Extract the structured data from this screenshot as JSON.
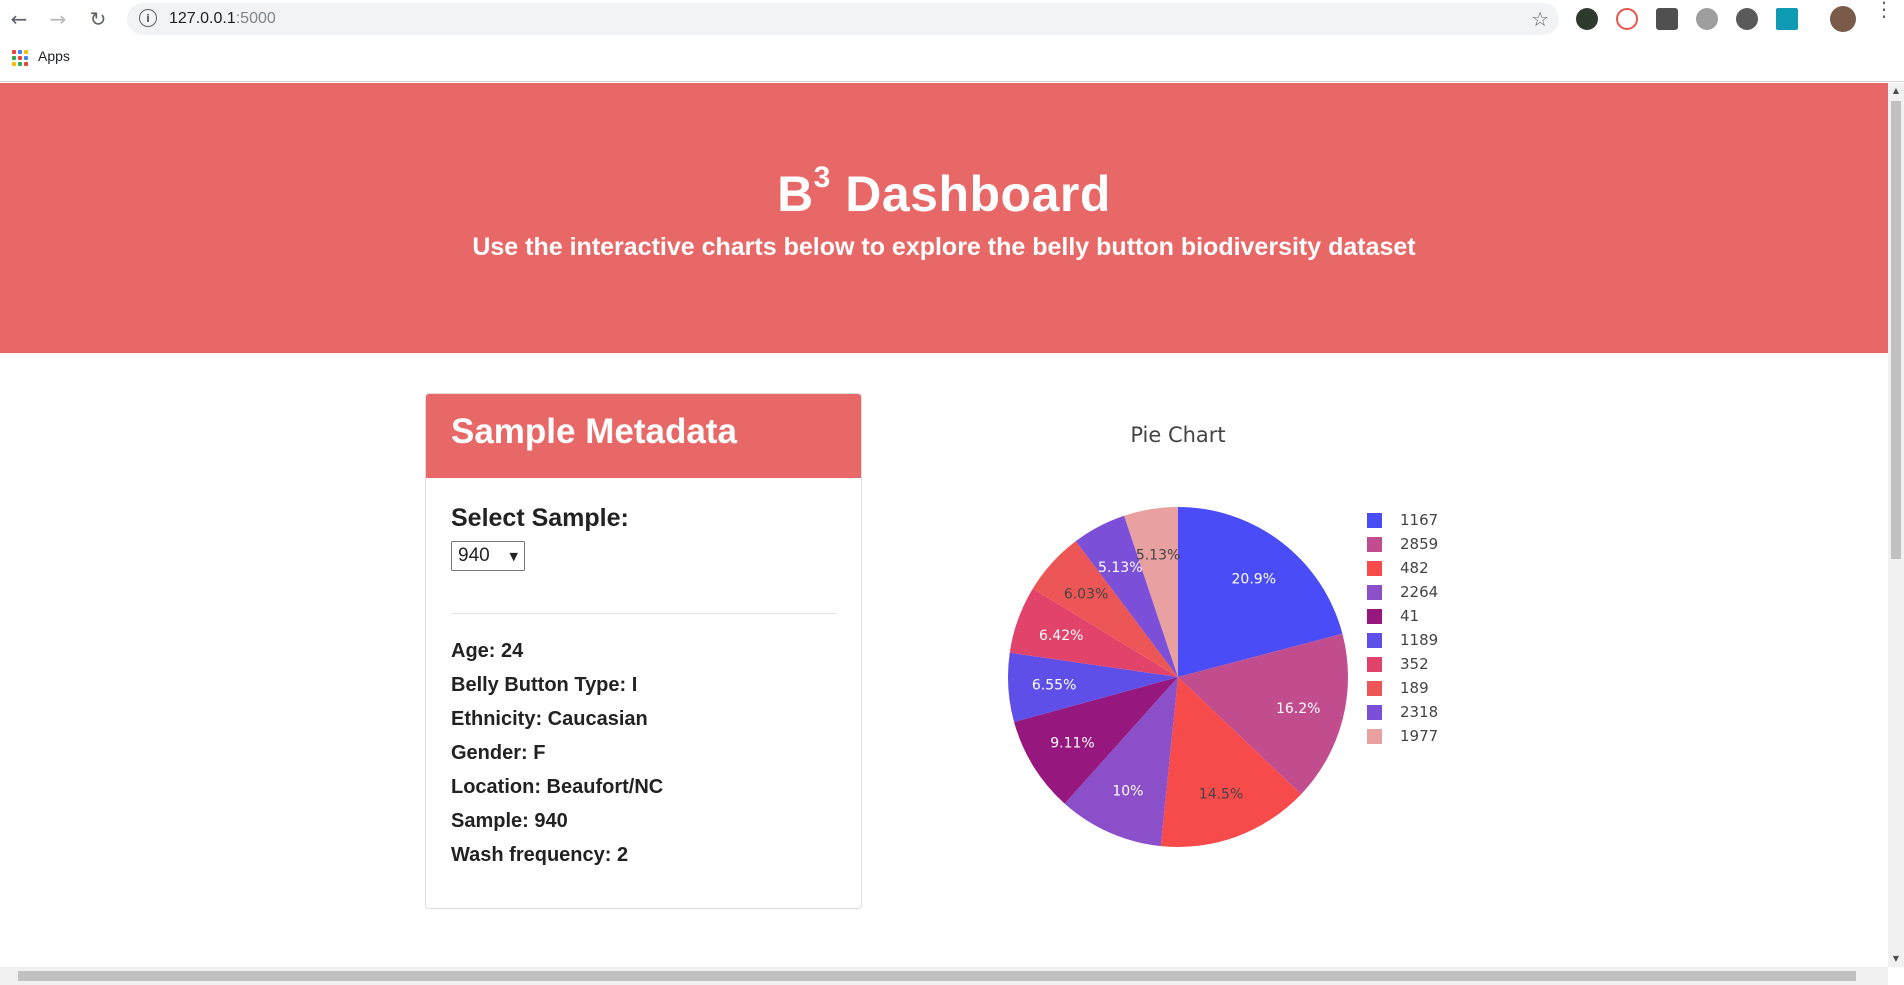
{
  "browser": {
    "url_host": "127.0.0.1",
    "url_port": ":5000",
    "bookmarks": {
      "apps_label": "Apps"
    }
  },
  "hero": {
    "title_main": "B",
    "title_sup": "3",
    "title_rest": " Dashboard",
    "subtitle": "Use the interactive charts below to explore the belly button biodiversity dataset"
  },
  "metadata_panel": {
    "heading": "Sample Metadata",
    "select_label": "Select Sample:",
    "selected_sample": "940",
    "fields": [
      "Age: 24",
      "Belly Button Type: I",
      "Ethnicity: Caucasian",
      "Gender: F",
      "Location: Beaufort/NC",
      "Sample: 940",
      "Wash frequency: 2"
    ]
  },
  "chart_data": {
    "type": "pie",
    "title": "Pie Chart",
    "legend_position": "right",
    "slices": [
      {
        "label": "1167",
        "percent": 20.9,
        "text": "20.9%",
        "color": "#4a4cf7"
      },
      {
        "label": "2859",
        "percent": 16.2,
        "text": "16.2%",
        "color": "#c14d8e"
      },
      {
        "label": "482",
        "percent": 14.5,
        "text": "14.5%",
        "color": "#f74a4a"
      },
      {
        "label": "2264",
        "percent": 10.0,
        "text": "10%",
        "color": "#8a4fc9"
      },
      {
        "label": "41",
        "percent": 9.11,
        "text": "9.11%",
        "color": "#96187f"
      },
      {
        "label": "1189",
        "percent": 6.55,
        "text": "6.55%",
        "color": "#5e4fe8"
      },
      {
        "label": "352",
        "percent": 6.42,
        "text": "6.42%",
        "color": "#e2436a"
      },
      {
        "label": "189",
        "percent": 6.03,
        "text": "6.03%",
        "color": "#ec5656"
      },
      {
        "label": "2318",
        "percent": 5.13,
        "text": "5.13%",
        "color": "#7c4fd8"
      },
      {
        "label": "1977",
        "percent": 5.13,
        "text": "5.13%",
        "color": "#e8a0a0"
      }
    ]
  }
}
